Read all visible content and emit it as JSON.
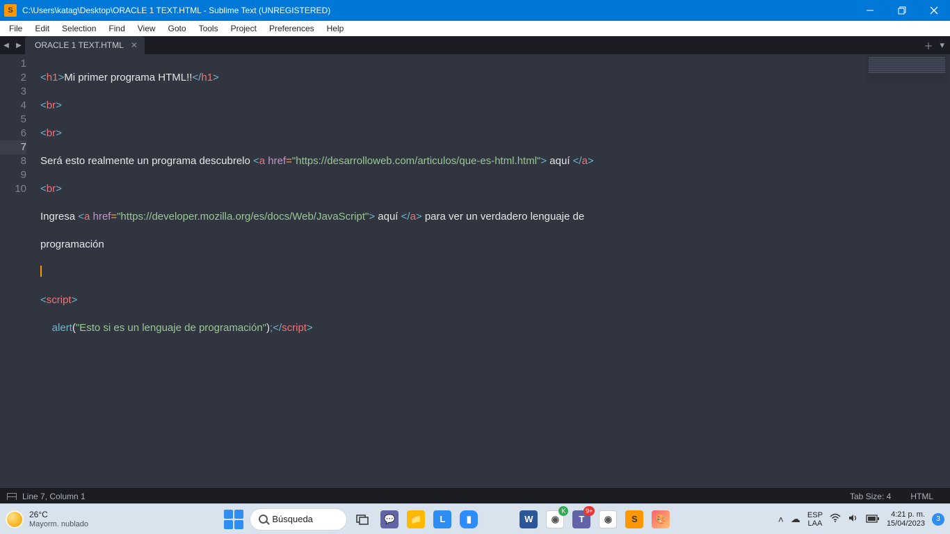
{
  "window": {
    "title": "C:\\Users\\katag\\Desktop\\ORACLE 1 TEXT.HTML - Sublime Text (UNREGISTERED)"
  },
  "menu": [
    "File",
    "Edit",
    "Selection",
    "Find",
    "View",
    "Goto",
    "Tools",
    "Project",
    "Preferences",
    "Help"
  ],
  "tab": {
    "label": "ORACLE 1 TEXT.HTML"
  },
  "status": {
    "cursor": "Line 7, Column 1",
    "tabsize": "Tab Size: 4",
    "syntax": "HTML"
  },
  "code": {
    "line_count": 10,
    "current_line": 7,
    "l1_text": "Mi primer programa HTML!!",
    "l4_text_a": "Será esto realmente un programa descubrelo ",
    "l4_href": "\"https://desarrolloweb.com/articulos/que-es-html.html\"",
    "l4_text_b": " aquí ",
    "l6_text_a": "Ingresa ",
    "l6_href": "\"https://developer.mozilla.org/es/docs/Web/JavaScript\"",
    "l6_text_b": " aquí ",
    "l6_text_c": " para ver un verdadero lenguaje de ",
    "l6_wrap": "programación",
    "l9_str": "\"Esto si es un lenguaje de programación\"",
    "l9_func": "alert"
  },
  "taskbar": {
    "weather_temp": "26°C",
    "weather_desc": "Mayorm. nublado",
    "search_placeholder": "Búsqueda",
    "lang_top": "ESP",
    "lang_bot": "LAA",
    "time": "4:21 p. m.",
    "date": "15/04/2023",
    "notif_count": "3",
    "teams_badge": "9+",
    "chrome_badge": "K"
  }
}
